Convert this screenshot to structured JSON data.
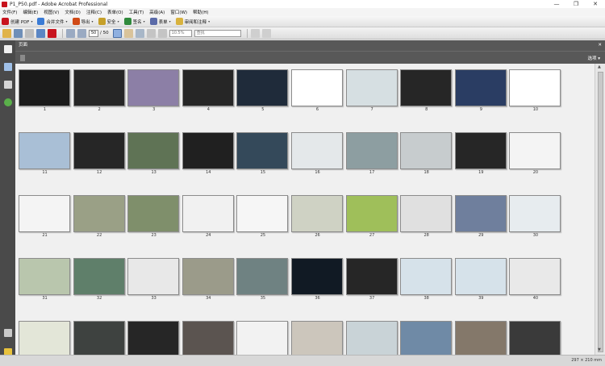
{
  "window": {
    "title": "P1_P50.pdf - Adobe Acrobat Professional",
    "buttons": [
      "—",
      "❐",
      "✕"
    ]
  },
  "menu": [
    "文件(F)",
    "编辑(E)",
    "视图(V)",
    "文档(D)",
    "注释(C)",
    "表单(O)",
    "工具(T)",
    "高级(A)",
    "窗口(W)",
    "帮助(H)"
  ],
  "toolbar1": [
    {
      "label": "创建 PDF",
      "icon": "create-pdf-icon",
      "color": "#c8141e"
    },
    {
      "label": "合并文件",
      "icon": "merge-files-icon",
      "color": "#3a7bd5"
    },
    {
      "label": "导出",
      "icon": "export-icon",
      "color": "#d04a16"
    },
    {
      "label": "安全",
      "icon": "lock-icon",
      "color": "#c6a02a"
    },
    {
      "label": "签名",
      "icon": "pen-icon",
      "color": "#2f8a3c"
    },
    {
      "label": "表单",
      "icon": "form-icon",
      "color": "#5a6aa8"
    },
    {
      "label": "审阅和注释",
      "icon": "review-icon",
      "color": "#d8b23e"
    }
  ],
  "toolbar2": {
    "current_page": "50",
    "total_pages": "/ 50",
    "zoom": "10.5%",
    "find_placeholder": "查找"
  },
  "panel": {
    "title": "页面",
    "close": "✕",
    "options": "选项 ▾"
  },
  "pages": [
    {
      "n": "1",
      "c": "#1b1b1b"
    },
    {
      "n": "2",
      "c": "#262626"
    },
    {
      "n": "3",
      "c": "#8c7fa6"
    },
    {
      "n": "4",
      "c": "#262626"
    },
    {
      "n": "5",
      "c": "#1f2b3a"
    },
    {
      "n": "6",
      "c": "#ffffff"
    },
    {
      "n": "7",
      "c": "#d6dfe2"
    },
    {
      "n": "8",
      "c": "#262626"
    },
    {
      "n": "9",
      "c": "#2a3d63"
    },
    {
      "n": "10",
      "c": "#ffffff"
    },
    {
      "n": "11",
      "c": "#a9bfd6"
    },
    {
      "n": "12",
      "c": "#262626"
    },
    {
      "n": "13",
      "c": "#5f7355"
    },
    {
      "n": "14",
      "c": "#202020"
    },
    {
      "n": "15",
      "c": "#34495a"
    },
    {
      "n": "16",
      "c": "#e4e8ea"
    },
    {
      "n": "17",
      "c": "#8d9ea1"
    },
    {
      "n": "18",
      "c": "#c7ccce"
    },
    {
      "n": "19",
      "c": "#262626"
    },
    {
      "n": "20",
      "c": "#f4f4f4"
    },
    {
      "n": "21",
      "c": "#f4f4f4"
    },
    {
      "n": "22",
      "c": "#9aa086"
    },
    {
      "n": "23",
      "c": "#7f8f6b"
    },
    {
      "n": "24",
      "c": "#f1f1f1"
    },
    {
      "n": "25",
      "c": "#f6f6f6"
    },
    {
      "n": "26",
      "c": "#cfd2c4"
    },
    {
      "n": "27",
      "c": "#9fbf5a"
    },
    {
      "n": "28",
      "c": "#e0e0e0"
    },
    {
      "n": "29",
      "c": "#6f7f9d"
    },
    {
      "n": "30",
      "c": "#e7ecef"
    },
    {
      "n": "31",
      "c": "#b9c6ad"
    },
    {
      "n": "32",
      "c": "#5f7f6a"
    },
    {
      "n": "33",
      "c": "#e8e8e8"
    },
    {
      "n": "34",
      "c": "#9b9b8a"
    },
    {
      "n": "35",
      "c": "#6f8282"
    },
    {
      "n": "36",
      "c": "#111a24"
    },
    {
      "n": "37",
      "c": "#262626"
    },
    {
      "n": "38",
      "c": "#d6e2ea"
    },
    {
      "n": "39",
      "c": "#d6e2ea"
    },
    {
      "n": "40",
      "c": "#e9e9e9"
    },
    {
      "n": "",
      "c": "#e3e6d8"
    },
    {
      "n": "",
      "c": "#3e4240"
    },
    {
      "n": "",
      "c": "#262626"
    },
    {
      "n": "",
      "c": "#5b5450"
    },
    {
      "n": "",
      "c": "#f2f2f2"
    },
    {
      "n": "",
      "c": "#ccc6bc"
    },
    {
      "n": "",
      "c": "#c9d3d7"
    },
    {
      "n": "",
      "c": "#6f8aa6"
    },
    {
      "n": "",
      "c": "#84786a"
    },
    {
      "n": "",
      "c": "#3a3a3a"
    }
  ],
  "status": {
    "page_size": "297 × 210 mm"
  },
  "colors": {
    "accent": "#c8141e",
    "panel": "#585858",
    "rail": "#4a4a4a"
  }
}
